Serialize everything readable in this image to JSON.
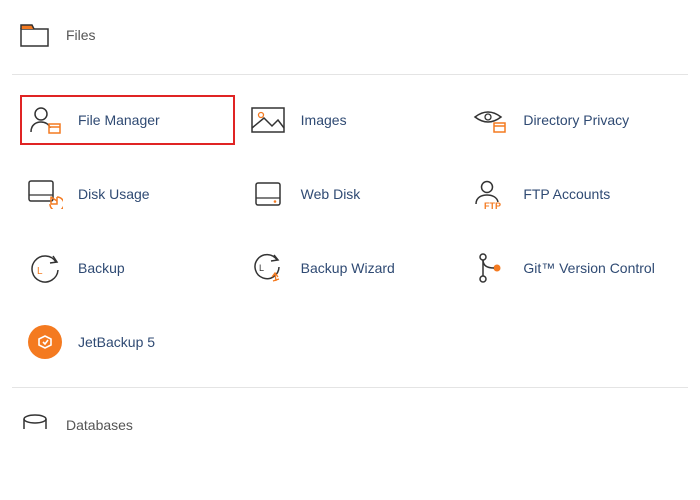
{
  "colors": {
    "accent": "#f47a20",
    "link": "#2f4a73",
    "stroke": "#333333",
    "highlight": "#e02424"
  },
  "sections": {
    "files": {
      "title": "Files",
      "items": [
        {
          "id": "file-manager",
          "label": "File Manager",
          "highlight": true
        },
        {
          "id": "images",
          "label": "Images"
        },
        {
          "id": "directory-privacy",
          "label": "Directory Privacy"
        },
        {
          "id": "disk-usage",
          "label": "Disk Usage"
        },
        {
          "id": "web-disk",
          "label": "Web Disk"
        },
        {
          "id": "ftp-accounts",
          "label": "FTP Accounts"
        },
        {
          "id": "backup",
          "label": "Backup"
        },
        {
          "id": "backup-wizard",
          "label": "Backup Wizard"
        },
        {
          "id": "git-version-control",
          "label": "Git™ Version Control"
        },
        {
          "id": "jetbackup-5",
          "label": "JetBackup 5"
        }
      ]
    },
    "databases": {
      "title": "Databases"
    }
  }
}
